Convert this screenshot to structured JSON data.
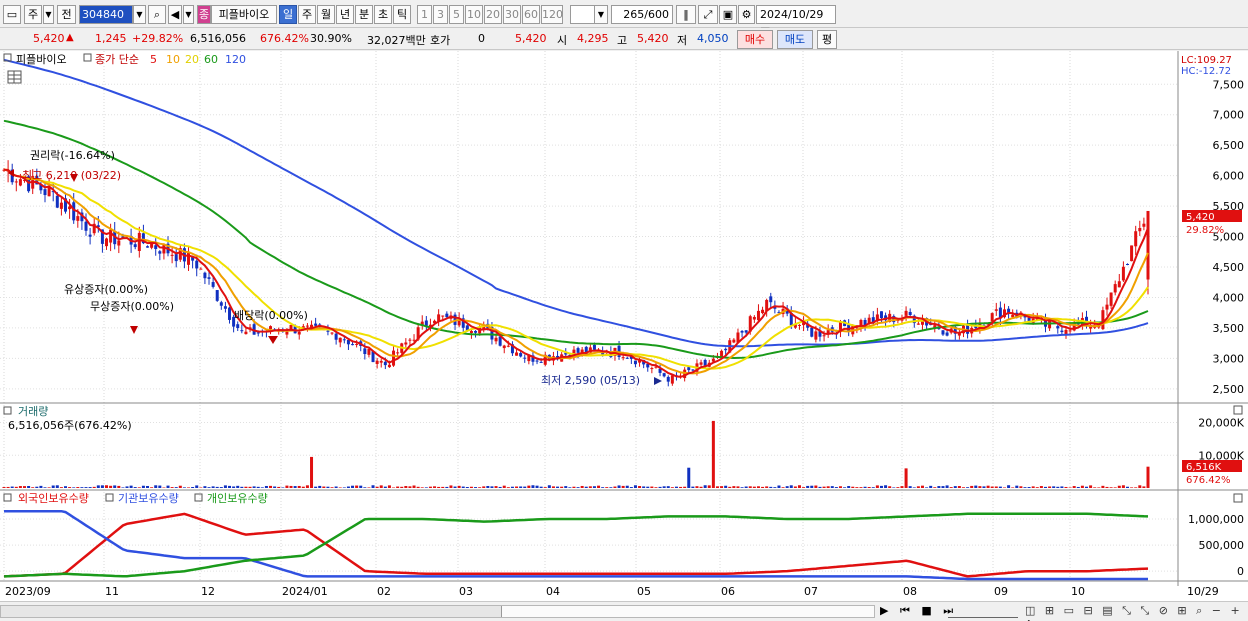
{
  "toolbar": {
    "market": "주",
    "prev": "전",
    "code": "304840",
    "name_badge": "종",
    "name": "피플바이오",
    "periods": [
      "일",
      "주",
      "월",
      "년",
      "분",
      "초",
      "틱"
    ],
    "active_period": "일",
    "intervals": [
      "1",
      "3",
      "5",
      "10",
      "20",
      "30",
      "60",
      "120"
    ],
    "count": "265",
    "count_max": "/600",
    "date": "2024/10/29"
  },
  "quote": {
    "price": "5,420",
    "change": "1,245",
    "change_pct": "+29.82%",
    "volume": "6,516,056",
    "volume_pct": "676.42%",
    "turnover": "30.90%",
    "amount": "32,027백만",
    "hoga_label": "호가",
    "hoga_val": "0",
    "hoga_price": "5,420",
    "open_label": "시",
    "open_val": "4,295",
    "high_label": "고",
    "high_val": "5,420",
    "low_label": "저",
    "low_val": "4,050",
    "buy_label": "매수",
    "sell_label": "매도",
    "pyeong_label": "평"
  },
  "price_panel": {
    "stock_label": "피플바이오",
    "legend_prefix": "종가 단순",
    "ma_labels": [
      "5",
      "10",
      "20",
      "60",
      "120"
    ],
    "ma_colors": [
      "#e01010",
      "#f0a000",
      "#f0e000",
      "#1a9a1a",
      "#3050e0"
    ],
    "lc_label": "LC:109.27",
    "hc_label": "HC:-12.72",
    "price_ticks": [
      "7,500",
      "7,000",
      "6,500",
      "6,000",
      "5,500",
      "5,000",
      "4,500",
      "4,000",
      "3,500",
      "3,000",
      "2,500"
    ],
    "last_price_label": "5,420",
    "last_pct_label": "29.82%",
    "annotations": {
      "rights": "권리락(-16.64%)",
      "high": "최고 6,210 (03/22)",
      "paid_in": "유상증자(0.00%)",
      "bonus": "무상증자(0.00%)",
      "dividend": "배당락(0.00%)",
      "low": "최저 2,590 (05/13)"
    }
  },
  "volume_panel": {
    "title": "거래량",
    "info": "6,516,056주(676.42%)",
    "ticks": [
      "20,000K",
      "10,000K"
    ],
    "last_label": "6,516K",
    "last_pct_label": "676.42%"
  },
  "holdings_panel": {
    "legend": [
      "외국인보유수량",
      "기관보유수량",
      "개인보유수량"
    ],
    "legend_colors": [
      "#e01010",
      "#3050e0",
      "#1a9a1a"
    ],
    "ticks": [
      "1,000,000",
      "500,000",
      "0"
    ]
  },
  "x_axis": {
    "labels": [
      "2023/09",
      "11",
      "12",
      "2024/01",
      "02",
      "03",
      "04",
      "05",
      "06",
      "07",
      "08",
      "09",
      "10"
    ],
    "end_label": "10/29"
  },
  "chart_data": {
    "type": "candlestick",
    "title": "피플바이오 (304840) 일봉",
    "x_range": [
      "2023/09",
      "2024/10/29"
    ],
    "ylim": [
      2300,
      7800
    ],
    "price_close_path": [
      {
        "date": "2023/09",
        "close": 6100
      },
      {
        "date": "2023/09",
        "close": 5700
      },
      {
        "date": "2023/10",
        "close": 5000
      },
      {
        "date": "2023/10",
        "close": 4900
      },
      {
        "date": "2023/10",
        "close": 4600
      },
      {
        "date": "2023/11",
        "close": 3400
      },
      {
        "date": "2023/11",
        "close": 3500
      },
      {
        "date": "2023/12",
        "close": 3400
      },
      {
        "date": "2023/12",
        "close": 2900
      },
      {
        "date": "2024/01",
        "close": 3700
      },
      {
        "date": "2024/01",
        "close": 3500
      },
      {
        "date": "2024/02",
        "close": 3000
      },
      {
        "date": "2024/03",
        "close": 3100
      },
      {
        "date": "2024/04",
        "close": 3100
      },
      {
        "date": "2024/05",
        "close": 2650
      },
      {
        "date": "2024/06",
        "close": 3000
      },
      {
        "date": "2024/06",
        "close": 3900
      },
      {
        "date": "2024/07",
        "close": 3400
      },
      {
        "date": "2024/07",
        "close": 3600
      },
      {
        "date": "2024/08",
        "close": 3700
      },
      {
        "date": "2024/08",
        "close": 3400
      },
      {
        "date": "2024/09",
        "close": 3800
      },
      {
        "date": "2024/09",
        "close": 3500
      },
      {
        "date": "2024/10",
        "close": 3600
      },
      {
        "date": "2024/10/29",
        "close": 5420
      }
    ],
    "last": {
      "close": 5420,
      "open": 4295,
      "high": 5420,
      "low": 4050,
      "change": 1245,
      "change_pct": 29.82,
      "volume": 6516056
    },
    "highest": {
      "value": 6210,
      "date": "03/22"
    },
    "lowest": {
      "value": 2590,
      "date": "05/13"
    },
    "volume_ylim": [
      0,
      22000000
    ],
    "volume_spikes": [
      {
        "date": "2024/01",
        "value": 9500000
      },
      {
        "date": "2024/06",
        "value": 20500000
      },
      {
        "date": "2024/06",
        "value": 6200000
      },
      {
        "date": "2024/08",
        "value": 6000000
      },
      {
        "date": "2024/10/29",
        "value": 6516056
      }
    ],
    "holdings_ylim": [
      -150000,
      1250000
    ],
    "series": [
      {
        "name": "외국인보유수량",
        "values": [
          -100000,
          -50000,
          900000,
          1100000,
          700000,
          800000,
          0,
          -50000,
          -50000,
          -50000,
          -50000,
          -50000,
          -50000,
          0,
          100000,
          200000,
          -100000,
          0,
          0,
          50000
        ]
      },
      {
        "name": "기관보유수량",
        "values": [
          1150000,
          1150000,
          400000,
          250000,
          250000,
          -100000,
          -100000,
          -100000,
          -100000,
          -100000,
          -100000,
          -100000,
          -100000,
          -100000,
          -100000,
          -100000,
          -150000,
          -150000,
          -150000,
          -150000
        ]
      },
      {
        "name": "개인보유수량",
        "values": [
          -100000,
          -50000,
          -100000,
          0,
          200000,
          300000,
          1000000,
          1000000,
          950000,
          1000000,
          1000000,
          1050000,
          1050000,
          1000000,
          1000000,
          1050000,
          1100000,
          1100000,
          1100000,
          1050000
        ]
      }
    ]
  }
}
